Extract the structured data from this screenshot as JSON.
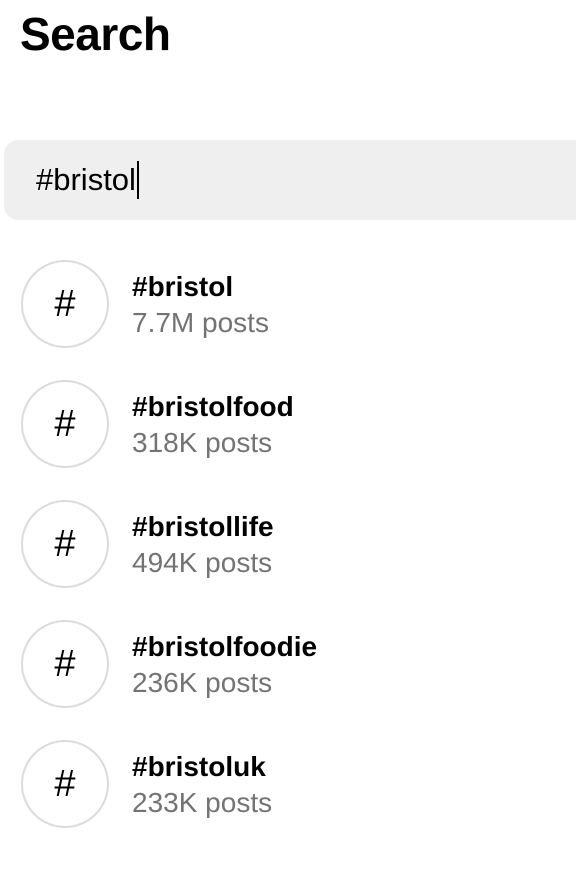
{
  "header": {
    "title": "Search"
  },
  "search": {
    "value": "#bristol",
    "placeholder": ""
  },
  "results": [
    {
      "icon": "hashtag-icon",
      "symbol": "#",
      "tag": "#bristol",
      "count": "7.7M posts"
    },
    {
      "icon": "hashtag-icon",
      "symbol": "#",
      "tag": "#bristolfood",
      "count": "318K posts"
    },
    {
      "icon": "hashtag-icon",
      "symbol": "#",
      "tag": "#bristollife",
      "count": "494K posts"
    },
    {
      "icon": "hashtag-icon",
      "symbol": "#",
      "tag": "#bristolfoodie",
      "count": "236K posts"
    },
    {
      "icon": "hashtag-icon",
      "symbol": "#",
      "tag": "#bristoluk",
      "count": "233K posts"
    }
  ],
  "colors": {
    "background": "#ffffff",
    "search_bg": "#efefef",
    "secondary_text": "#737373",
    "circle_border": "#dbdbdb"
  }
}
